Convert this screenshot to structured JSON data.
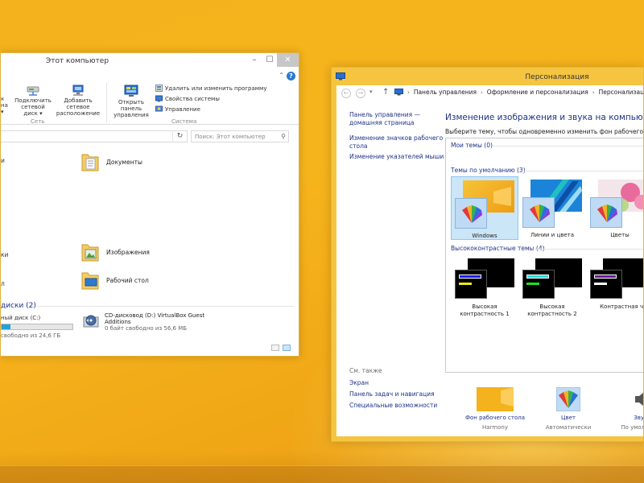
{
  "explorer": {
    "title": "Этот компьютер",
    "ribbon": {
      "cut_label_1": "к",
      "cut_label_2": "на",
      "map_drive": [
        "Подключить",
        "сетевой диск"
      ],
      "add_location": [
        "Добавить сетевое",
        "расположение"
      ],
      "open_control_panel": [
        "Открыть панель",
        "управления"
      ],
      "uninstall": "Удалить или изменить программу",
      "system_properties": "Свойства системы",
      "manage": "Управление",
      "group_network": "Сеть",
      "group_system": "Система"
    },
    "search": {
      "placeholder": "Поиск: Этот компьютер"
    },
    "left_cut_labels": [
      "и",
      "ки",
      "л"
    ],
    "folders": [
      {
        "label": "Документы",
        "icon": "documents-folder-icon"
      },
      {
        "label": "Изображения",
        "icon": "pictures-folder-icon"
      },
      {
        "label": "Рабочий стол",
        "icon": "desktop-folder-icon"
      }
    ],
    "drives_header": "диски (2)",
    "drive_c": {
      "label": "ный диск (C:)",
      "free": "свободно из 24,6 ГБ",
      "used_fraction": 0.12
    },
    "drive_d": {
      "label": [
        "CD-дисковод (D:) VirtualBox Guest",
        "Additions"
      ],
      "free": "0 байт свободно из 56,6 МБ"
    }
  },
  "personalization": {
    "title": "Персонализация",
    "breadcrumbs": [
      "Панель управления",
      "Оформление и персонализация",
      "Персонализация"
    ],
    "left_links": {
      "home": [
        "Панель управления —",
        "домашняя страница"
      ],
      "desktop_icons": [
        "Изменение значков рабочего",
        "стола"
      ],
      "mouse_pointers": "Изменение указателей мыши",
      "see_also": "См. также",
      "screen": "Экран",
      "taskbar": "Панель задач и навигация",
      "accessibility": "Специальные возможности"
    },
    "heading": "Изменение изображения и звука на компьютере",
    "description": "Выберите тему, чтобы одновременно изменить фон рабочего стола, цвет",
    "sections": {
      "my_themes": "Мои темы (0)",
      "default_themes": "Темы по умолчанию (3)",
      "high_contrast": "Высококонтрастные темы (4)"
    },
    "themes": [
      {
        "label": "Windows",
        "selected": true,
        "bg": "#f4b21c"
      },
      {
        "label": "Линии и цвета",
        "selected": false,
        "bg": "#1b84d8"
      },
      {
        "label": "Цветы",
        "selected": false,
        "bg": "#e96b9b"
      }
    ],
    "hc_themes": [
      {
        "label": [
          "Высокая",
          "контрастность 1"
        ],
        "bar1": "#1a1aff",
        "bar2": "#e8e81a"
      },
      {
        "label": [
          "Высокая",
          "контрастность 2"
        ],
        "bar1": "#20e0e0",
        "bar2": "#20e020"
      },
      {
        "label": [
          "Контрастная черная",
          ""
        ],
        "bar1": "#6a1a9a",
        "bar2": "#ffffff"
      }
    ],
    "bottom": [
      {
        "label": "Фон рабочего стола",
        "sub": "Harmony"
      },
      {
        "label": "Цвет",
        "sub": "Автоматически"
      },
      {
        "label": "Звуки",
        "sub": "По умолчанию"
      }
    ]
  },
  "colors": {
    "accent": "#f4b21c",
    "link": "#1e3287",
    "selection": "#cbe6f7"
  }
}
